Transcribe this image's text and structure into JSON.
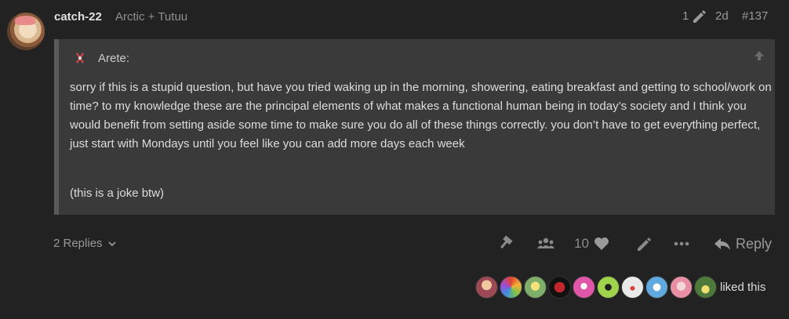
{
  "post": {
    "username": "catch-22",
    "user_title": "Arctic + Tutuu",
    "edit_count": "1",
    "date": "2d",
    "post_number": "#137"
  },
  "quote": {
    "author": "Arete:",
    "paragraph1": "sorry if this is a stupid question, but have you tried waking up in the morning, showering, eating breakfast and getting to school/work on time? to my knowledge these are the principal elements of what makes a functional human being in today’s society and I think you would benefit from setting aside some time to make sure you do all of these things correctly. you don’t have to get everything perfect, just start with Mondays until you feel like you can add more days each week",
    "paragraph2": "(this is a joke btw)"
  },
  "actions": {
    "replies_label": "2 Replies",
    "like_count": "10",
    "reply_label": "Reply"
  },
  "likes": {
    "liked_text": "liked this",
    "avatars": [
      "#9b4a55",
      "#d86f3f",
      "#7fae6a",
      "#c0262c",
      "#e056a8",
      "#9fd34c",
      "#e9e9e9",
      "#5fa8e0",
      "#e88fa5",
      "#4d7a3a"
    ]
  },
  "colors": {
    "background": "#222222",
    "quote_background": "#3a3a3a",
    "muted_text": "#999999"
  },
  "icons": [
    "pencil-icon",
    "arrow-up-icon",
    "chevron-down-icon",
    "hammer-icon",
    "users-icon",
    "heart-icon",
    "pencil-icon",
    "ellipsis-icon",
    "reply-icon"
  ]
}
